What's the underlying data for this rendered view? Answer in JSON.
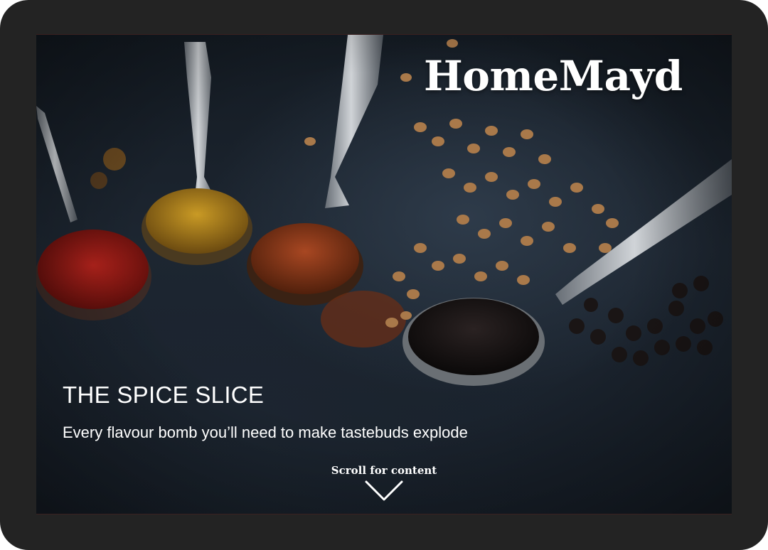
{
  "brand": {
    "name": "HomeMayd"
  },
  "hero": {
    "title": "THE SPICE SLICE",
    "subtitle": "Every flavour bomb you’ll need to make tastebuds explode",
    "scroll_label": "Scroll for content",
    "scroll_icon": "chevron-down-icon",
    "background_image": "spices-on-spoons-photo"
  },
  "colors": {
    "device_frame": "#232323",
    "background": "#1d2631",
    "text": "#ffffff"
  }
}
